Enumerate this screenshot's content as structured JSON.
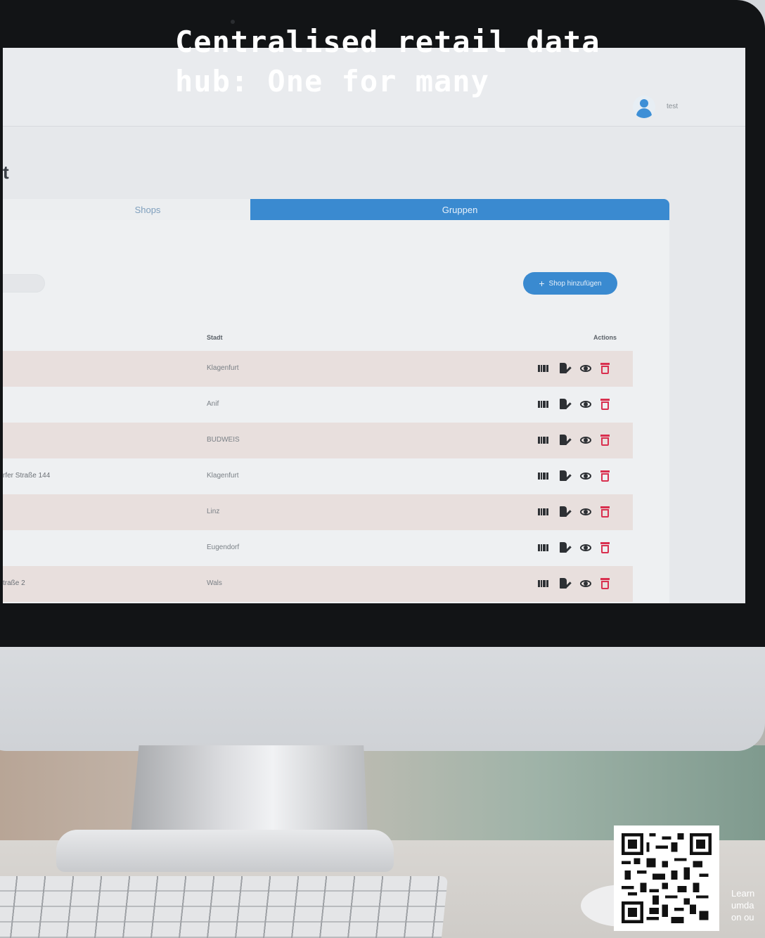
{
  "headline": {
    "line1": "Centralised retail data",
    "line2": "hub: One for many"
  },
  "app": {
    "user": {
      "name": "test"
    },
    "page_title": "t",
    "tabs": [
      {
        "label": "Shops",
        "active": false
      },
      {
        "label": "Gruppen",
        "active": true
      }
    ],
    "add_button": {
      "label": "Shop hinzufügen",
      "icon": "plus-icon"
    },
    "table": {
      "headers": {
        "stadt": "Stadt",
        "actions": "Actions"
      },
      "rows": [
        {
          "street": "",
          "city": "Klagenfurt"
        },
        {
          "street": "",
          "city": "Anif"
        },
        {
          "street": "",
          "city": "BUDWEIS"
        },
        {
          "street": "rfer Straße 144",
          "city": "Klagenfurt"
        },
        {
          "street": "",
          "city": "Linz"
        },
        {
          "street": "",
          "city": "Eugendorf"
        },
        {
          "street": "traße 2",
          "city": "Wals"
        }
      ],
      "row_actions": [
        "barcode-icon",
        "edit-icon",
        "view-icon",
        "delete-icon"
      ]
    },
    "colors": {
      "accent": "#3a8ad0",
      "delete": "#d9304f",
      "row_highlight": "#e8dfdd"
    }
  },
  "qr": {
    "caption": [
      "Learn",
      "umda",
      "on ou"
    ]
  }
}
